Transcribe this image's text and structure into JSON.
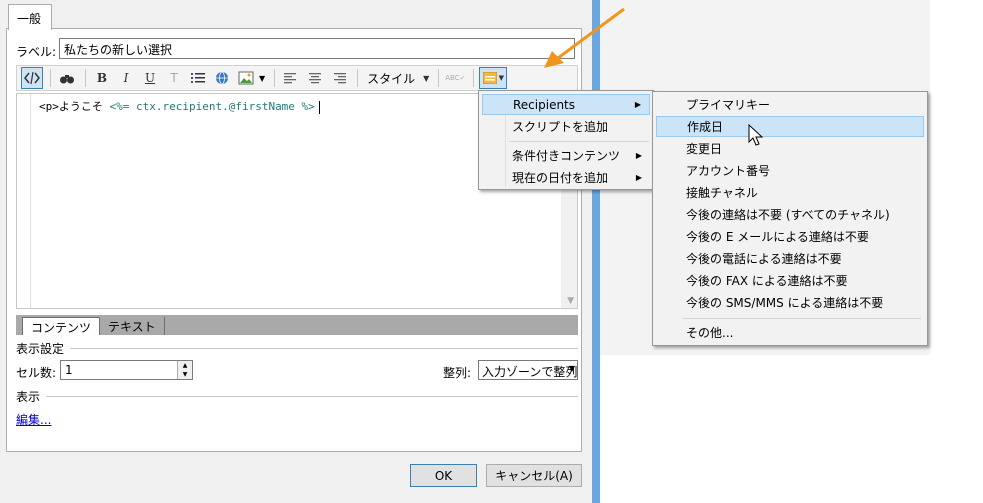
{
  "dialog": {
    "tab_label": "一般",
    "label_caption": "ラベル:",
    "label_value": "私たちの新しい選択"
  },
  "toolbar": {
    "style_label": "スタイル",
    "icons": [
      "source-icon",
      "find-icon",
      "bold-icon",
      "italic-icon",
      "underline-icon",
      "clear-format-icon",
      "list-icon",
      "link-icon",
      "image-icon",
      "align-left-icon",
      "align-center-icon",
      "align-right-icon",
      "spellcheck-icon",
      "insert-field-icon"
    ]
  },
  "editor": {
    "code_tag": "<p>ようこそ",
    "code_expression": "<%= ctx.recipient.@firstName %>"
  },
  "mode_tabs": [
    "コンテンツ",
    "テキスト"
  ],
  "display_settings": {
    "heading": "表示設定",
    "cells_label": "セル数:",
    "cells_value": "1",
    "align_label": "整列:",
    "align_value": "入力ゾーンで整列"
  },
  "display": {
    "heading": "表示",
    "edit_link": "編集..."
  },
  "buttons": {
    "ok": "OK",
    "cancel": "キャンセル(A)"
  },
  "menu1": {
    "items": [
      {
        "label": "Recipients",
        "has_submenu": true,
        "highlighted": true
      },
      {
        "label": "スクリプトを追加",
        "has_submenu": false
      },
      {
        "label": "条件付きコンテンツ",
        "has_submenu": true
      },
      {
        "label": "現在の日付を追加",
        "has_submenu": true
      }
    ]
  },
  "menu2": {
    "items": [
      "プライマリキー",
      "作成日",
      "変更日",
      "アカウント番号",
      "接触チャネル",
      "今後の連絡は不要 (すべてのチャネル)",
      "今後の E メールによる連絡は不要",
      "今後の電話による連絡は不要",
      "今後の FAX による連絡は不要",
      "今後の SMS/MMS による連絡は不要"
    ],
    "highlighted_item": "作成日",
    "more_label": "その他..."
  },
  "colors": {
    "accent_arrow": "#f0961e",
    "highlight": "#cce4f7",
    "window_border": "#6aa6e0"
  }
}
